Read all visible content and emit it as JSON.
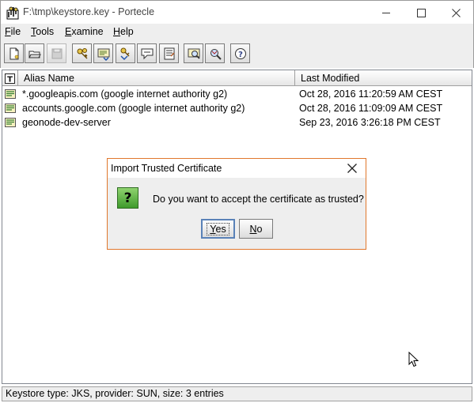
{
  "window": {
    "title": "F:\\tmp\\keystore.key - Portecle"
  },
  "menu": {
    "file": "File",
    "tools": "Tools",
    "examine": "Examine",
    "help": "Help"
  },
  "toolbar": {
    "buttons": [
      {
        "icon": "new-keystore-icon"
      },
      {
        "icon": "open-keystore-icon"
      },
      {
        "icon": "save-keystore-icon",
        "disabled": true
      },
      {
        "icon": "generate-keypair-icon"
      },
      {
        "icon": "import-trusted-cert-icon"
      },
      {
        "icon": "import-keypair-icon"
      },
      {
        "icon": "set-password-icon"
      },
      {
        "icon": "keystore-report-icon"
      },
      {
        "icon": "examine-certificate-icon"
      },
      {
        "icon": "examine-ssl-icon"
      },
      {
        "icon": "help-icon"
      }
    ]
  },
  "table": {
    "type_header": "T",
    "alias_header": "Alias Name",
    "modified_header": "Last Modified",
    "rows": [
      {
        "alias": "*.googleapis.com (google internet authority g2)",
        "modified": "Oct 28, 2016 11:20:59 AM CEST"
      },
      {
        "alias": "accounts.google.com (google internet authority g2)",
        "modified": "Oct 28, 2016 11:09:09 AM CEST"
      },
      {
        "alias": "geonode-dev-server",
        "modified": "Sep 23, 2016 3:26:18 PM CEST"
      }
    ]
  },
  "status": {
    "text": "Keystore type: JKS, provider: SUN, size: 3 entries"
  },
  "dialog": {
    "title": "Import Trusted Certificate",
    "message": "Do you want to accept the certificate as trusted?",
    "icon": "?",
    "yes_label_u": "Y",
    "yes_label_rest": "es",
    "no_label_u": "N",
    "no_label_rest": "o"
  },
  "colors": {
    "dialog_border": "#e0772c",
    "question_icon": "#4caf3a"
  }
}
